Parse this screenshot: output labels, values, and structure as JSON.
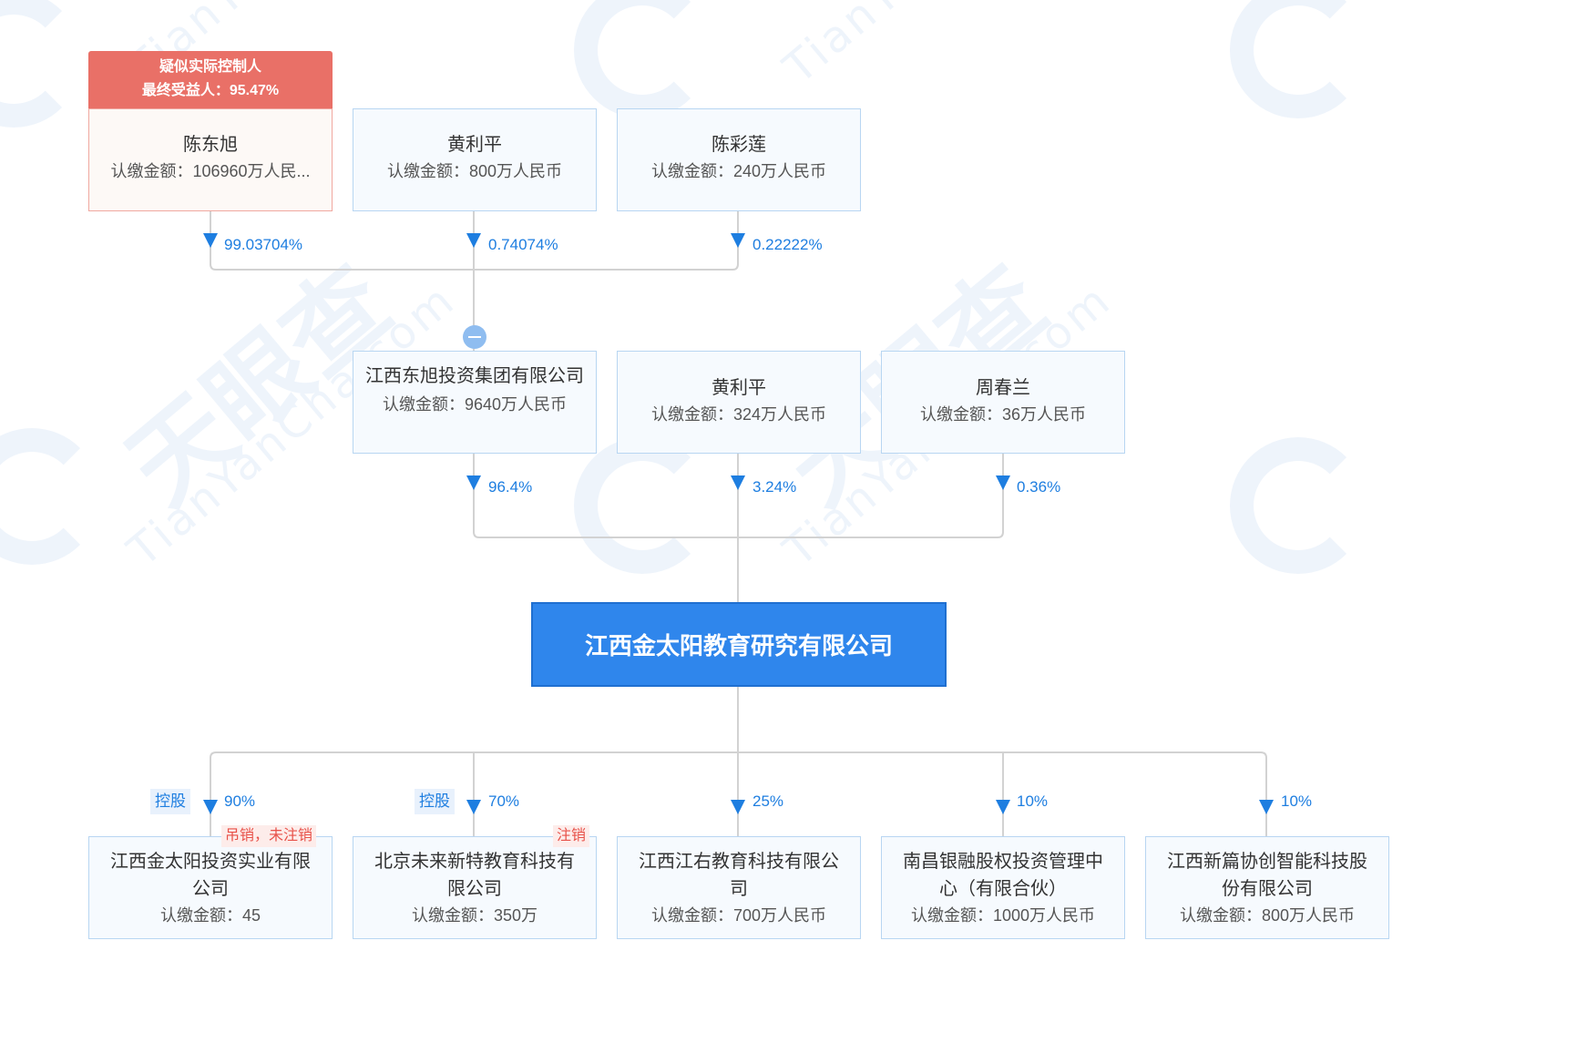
{
  "controller_tag": {
    "line1": "疑似实际控制人",
    "line2": "最终受益人：95.47%"
  },
  "top_shareholders": [
    {
      "name": "陈东旭",
      "amount": "认缴金额：106960万人民...",
      "pct": "99.03704%"
    },
    {
      "name": "黄利平",
      "amount": "认缴金额：800万人民币",
      "pct": "0.74074%"
    },
    {
      "name": "陈彩莲",
      "amount": "认缴金额：240万人民币",
      "pct": "0.22222%"
    }
  ],
  "mid_shareholders": [
    {
      "name": "江西东旭投资集团有限公司",
      "amount": "认缴金额：9640万人民币",
      "pct": "96.4%"
    },
    {
      "name": "黄利平",
      "amount": "认缴金额：324万人民币",
      "pct": "3.24%"
    },
    {
      "name": "周春兰",
      "amount": "认缴金额：36万人民币",
      "pct": "0.36%"
    }
  ],
  "main_company": "江西金太阳教育研究有限公司",
  "subsidiaries": [
    {
      "name": "江西金太阳投资实业有限公司",
      "amount": "认缴金额：45",
      "pct": "90%",
      "tag": "控股",
      "status": "吊销，未注销"
    },
    {
      "name": "北京未来新特教育科技有限公司",
      "amount": "认缴金额：350万",
      "pct": "70%",
      "tag": "控股",
      "status": "注销"
    },
    {
      "name": "江西江右教育科技有限公司",
      "amount": "认缴金额：700万人民币",
      "pct": "25%"
    },
    {
      "name": "南昌银融股权投资管理中心（有限合伙）",
      "amount": "认缴金额：1000万人民币",
      "pct": "10%"
    },
    {
      "name": "江西新篇协创智能科技股份有限公司",
      "amount": "认缴金额：800万人民币",
      "pct": "10%"
    }
  ],
  "watermark": {
    "brand": "天眼查",
    "latin": "TianYanCha.com"
  },
  "colors": {
    "accent": "#2f86ec",
    "line": "#d2d2d2",
    "percent": "#1e7ee0",
    "controller": "#e97067",
    "status": "#e8524a"
  }
}
